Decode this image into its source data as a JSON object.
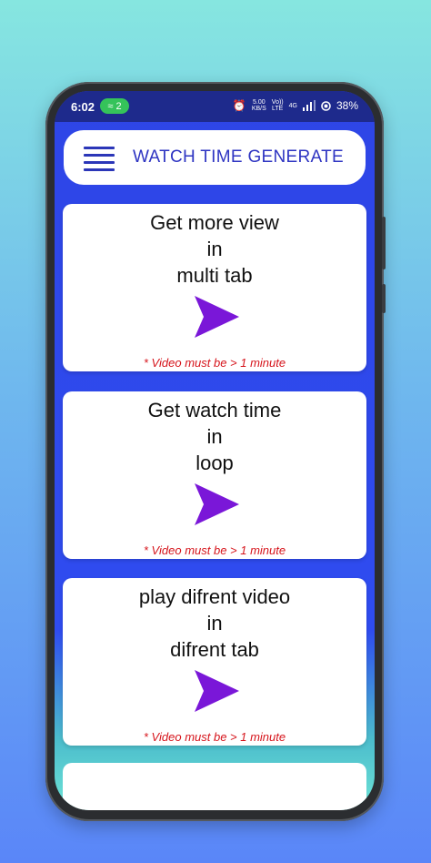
{
  "status": {
    "time": "6:02",
    "pill_count": "2",
    "net_speed": "5.00",
    "net_unit": "KB/S",
    "vo_line1": "Vo))",
    "vo_line2": "LTE",
    "signal_label": "4G",
    "battery": "38%"
  },
  "appbar": {
    "title": "WATCH TIME GENERATE",
    "menu_icon": "hamburger-menu-icon"
  },
  "cards": [
    {
      "title": "Get more view\nin\nmulti tab",
      "note": "* Video must be > 1 minute",
      "icon": "play-arrow-icon"
    },
    {
      "title": "Get watch time\nin\nloop",
      "note": "* Video must be > 1 minute",
      "icon": "play-arrow-icon"
    },
    {
      "title": "play difrent video\nin\n difrent tab",
      "note": "* Video must be > 1 minute",
      "icon": "play-arrow-icon"
    }
  ],
  "colors": {
    "accent": "#2e34c2",
    "play": "#7a17d8",
    "note": "#d6141b",
    "statusbar": "#1e2a8c"
  }
}
